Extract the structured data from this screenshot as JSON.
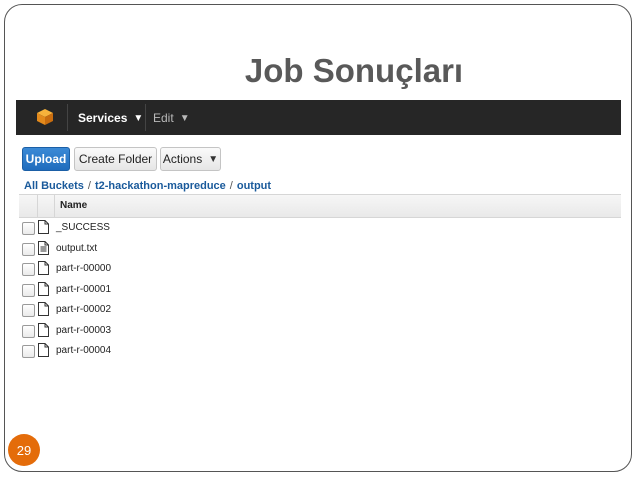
{
  "slide": {
    "title": "Job Sonuçları",
    "page_number": "29"
  },
  "navbar": {
    "services_label": "Services",
    "edit_label": "Edit"
  },
  "toolbar": {
    "upload_label": "Upload",
    "create_folder_label": "Create Folder",
    "actions_label": "Actions"
  },
  "breadcrumb": {
    "root": "All Buckets",
    "bucket": "t2-hackathon-mapreduce",
    "folder": "output",
    "separator": "/"
  },
  "table": {
    "header_name": "Name",
    "rows": [
      {
        "name": "_SUCCESS",
        "icon": "file-icon"
      },
      {
        "name": "output.txt",
        "icon": "text-file-icon"
      },
      {
        "name": "part-r-00000",
        "icon": "file-icon"
      },
      {
        "name": "part-r-00001",
        "icon": "file-icon"
      },
      {
        "name": "part-r-00002",
        "icon": "file-icon"
      },
      {
        "name": "part-r-00003",
        "icon": "file-icon"
      },
      {
        "name": "part-r-00004",
        "icon": "file-icon"
      }
    ]
  },
  "colors": {
    "accent": "#e46c0a",
    "navbar": "#262626",
    "primary_button": "#1f6cbd",
    "link": "#1a5a9b"
  }
}
